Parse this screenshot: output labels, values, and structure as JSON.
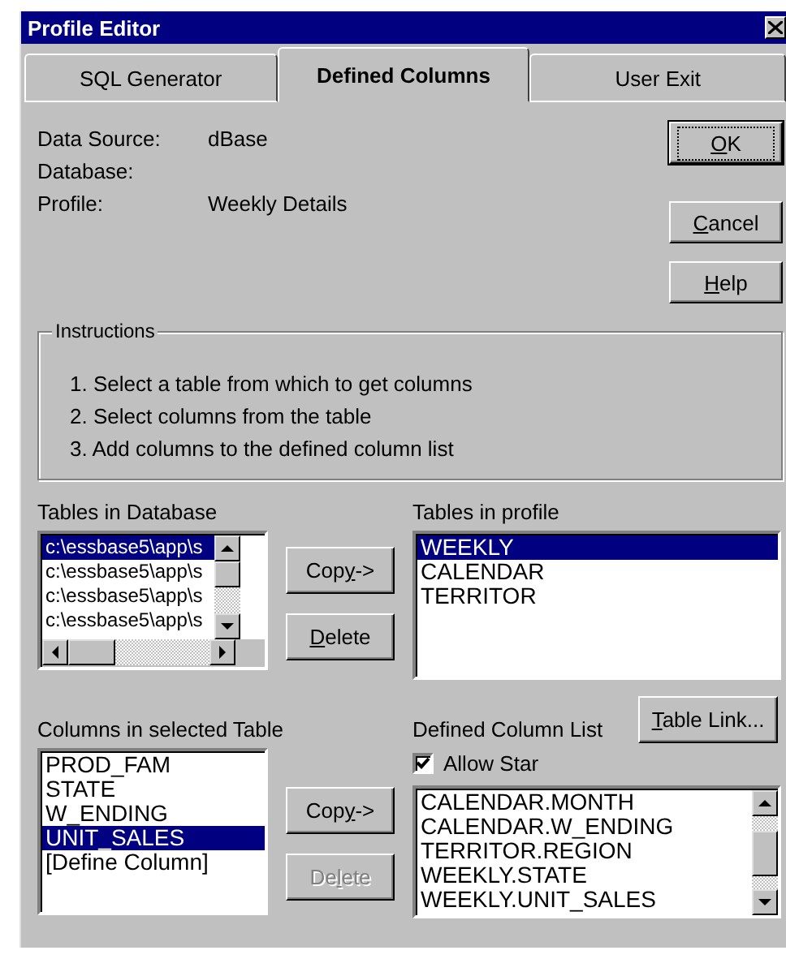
{
  "window": {
    "title": "Profile Editor"
  },
  "tabs": [
    {
      "label": "SQL Generator",
      "selected": false
    },
    {
      "label": "Defined Columns",
      "selected": true
    },
    {
      "label": "User Exit",
      "selected": false
    }
  ],
  "info": [
    {
      "label": "Data Source:",
      "value": "dBase"
    },
    {
      "label": "Database:"
    },
    {
      "label": "Profile:",
      "value": "Weekly Details"
    }
  ],
  "dialog_buttons": [
    {
      "parts": [
        {
          "text": "O",
          "underline": true
        },
        {
          "text": "K",
          "underline": false
        }
      ],
      "default": true
    },
    {
      "parts": [
        {
          "text": "C",
          "underline": true
        },
        {
          "text": "ancel",
          "underline": false
        }
      ],
      "default": false
    },
    {
      "parts": [
        {
          "text": "H",
          "underline": true
        },
        {
          "text": "elp",
          "underline": false
        }
      ],
      "default": false
    }
  ],
  "instructions": {
    "title": "Instructions",
    "lines": [
      "1. Select a table from which to get columns",
      "2. Select columns from the table",
      "3. Add columns to the defined column list"
    ]
  },
  "tables_in_database": {
    "label": "Tables in Database",
    "items": [
      {
        "text": "c:\\essbase5\\app\\s",
        "selected": true
      },
      {
        "text": "c:\\essbase5\\app\\s",
        "selected": false
      },
      {
        "text": "c:\\essbase5\\app\\s",
        "selected": false
      },
      {
        "text": "c:\\essbase5\\app\\s",
        "selected": false
      }
    ]
  },
  "table_buttons": [
    {
      "parts": [
        {
          "text": "Cop",
          "underline": false
        },
        {
          "text": "y",
          "underline": true
        },
        {
          "text": "->",
          "underline": false
        }
      ],
      "disabled": false
    },
    {
      "parts": [
        {
          "text": "D",
          "underline": true
        },
        {
          "text": "elete",
          "underline": false
        }
      ],
      "disabled": false
    }
  ],
  "tables_in_profile": {
    "label": "Tables in profile",
    "items": [
      {
        "text": "WEEKLY",
        "selected": true
      },
      {
        "text": "CALENDAR",
        "selected": false
      },
      {
        "text": "TERRITOR",
        "selected": false
      }
    ]
  },
  "columns_in_table": {
    "label": "Columns in selected Table",
    "items": [
      {
        "text": "PROD_FAM",
        "selected": false
      },
      {
        "text": "STATE",
        "selected": false
      },
      {
        "text": "W_ENDING",
        "selected": false
      },
      {
        "text": "UNIT_SALES",
        "selected": true
      },
      {
        "text": "[Define Column]",
        "selected": false
      }
    ]
  },
  "column_buttons": [
    {
      "parts": [
        {
          "text": "Cop",
          "underline": false
        },
        {
          "text": "y",
          "underline": true
        },
        {
          "text": "->",
          "underline": false
        }
      ],
      "disabled": false
    },
    {
      "parts": [
        {
          "text": "De",
          "underline": false
        },
        {
          "text": "l",
          "underline": true
        },
        {
          "text": "ete",
          "underline": false
        }
      ],
      "disabled": true
    }
  ],
  "table_link_button": {
    "parts": [
      {
        "text": "T",
        "underline": true
      },
      {
        "text": "able Link...",
        "underline": false
      }
    ]
  },
  "defined_columns": {
    "label": "Defined Column List",
    "allow_star": {
      "label": "Allow Star",
      "checked": true
    },
    "items": [
      "CALENDAR.MONTH",
      "CALENDAR.W_ENDING",
      "TERRITOR.REGION",
      "WEEKLY.STATE",
      "WEEKLY.UNIT_SALES"
    ]
  }
}
